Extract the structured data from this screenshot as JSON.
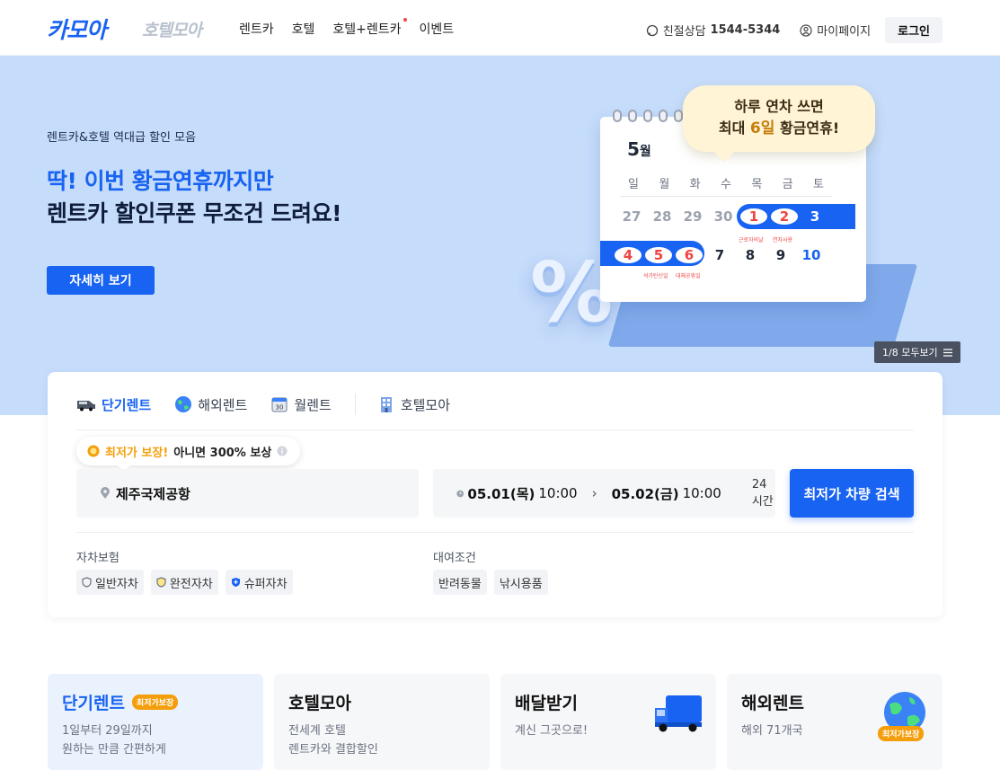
{
  "header": {
    "logo": "카모아",
    "logo_secondary": "호텔모아",
    "nav": [
      "렌트카",
      "호텔",
      "호텔+렌트카",
      "이벤트"
    ],
    "consult_label": "친절상담",
    "consult_phone": "1544-5344",
    "mypage": "마이페이지",
    "login": "로그인"
  },
  "hero": {
    "subtitle": "렌트카&호텔 역대급 할인 모음",
    "title_line1_blue": "딱! 이번 황금연휴까지만",
    "title_line2": "렌트카 할인쿠폰 무조건 드려요!",
    "detail_button": "자세히 보기",
    "pager": "1/8 모두보기",
    "bubble_line1": "하루 연차 쓰면",
    "bubble_line2_pre": "최대",
    "bubble_line2_gold": "6일",
    "bubble_line2_post": "황금연휴!",
    "calendar": {
      "month_num": "5",
      "month_unit": "월",
      "weekdays": [
        "일",
        "월",
        "화",
        "수",
        "목",
        "금",
        "토"
      ],
      "week1": [
        "27",
        "28",
        "29",
        "30",
        "1",
        "2",
        "3"
      ],
      "week2": [
        "4",
        "5",
        "6",
        "7",
        "8",
        "9",
        "10"
      ],
      "note1": "근로자의날",
      "note2": "연차사용",
      "note3": "석가탄신일",
      "note4": "대체공휴일",
      "percent": "%"
    }
  },
  "search": {
    "tabs": [
      "단기렌트",
      "해외렌트",
      "월렌트",
      "호텔모아"
    ],
    "guarantee_orange": "최저가 보장!",
    "guarantee_rest": "아니면 300% 보상",
    "location": "제주국제공항",
    "start_date": "05.01(목)",
    "start_time": "10:00",
    "end_date": "05.02(금)",
    "end_time": "10:00",
    "duration": "24시간",
    "search_button": "최저가 차량 검색",
    "insurance_label": "자차보험",
    "insurance_options": [
      "일반자차",
      "완전자차",
      "슈퍼자차"
    ],
    "rental_label": "대여조건",
    "rental_options": [
      "반려동물",
      "낚시용품"
    ]
  },
  "services": [
    {
      "title": "단기렌트",
      "tag": "최저가보장",
      "desc1": "1일부터 29일까지",
      "desc2": "원하는 만큼 간편하게"
    },
    {
      "title": "호텔모아",
      "desc1": "전세계 호텔",
      "desc2": "렌트카와 결합할인"
    },
    {
      "title": "배달받기",
      "desc1": "계신 그곳으로!"
    },
    {
      "title": "해외렌트",
      "desc1": "해외 71개국",
      "tag": "최저가보장"
    }
  ],
  "colors": {
    "brand": "#1863f2",
    "hero_bg": "#c6dcfb",
    "accent_orange": "#f59e0b"
  }
}
